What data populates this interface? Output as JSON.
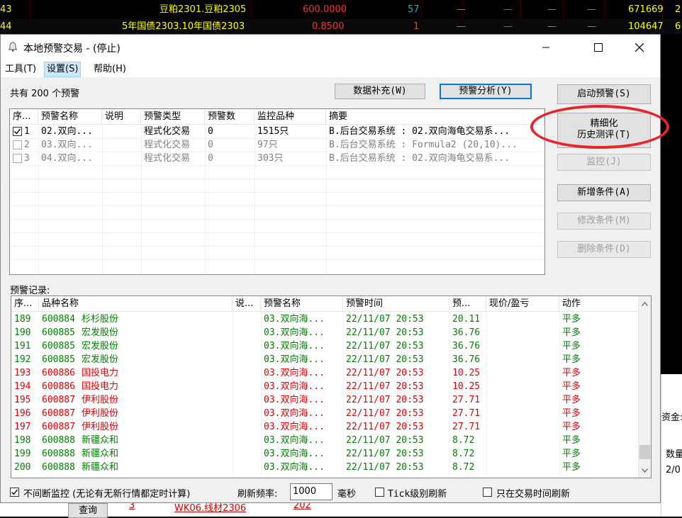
{
  "background": {
    "row1": {
      "idx": "43",
      "name": "豆粕2301.豆粕2305",
      "price": "600.0000",
      "vol": "57",
      "d1": "—",
      "d2": "—",
      "d3": "—",
      "d4": "—",
      "amount": "671669",
      "tail": "2"
    },
    "row2": {
      "idx": "44",
      "name": "5年国债2303.10年国债2303",
      "price": "0.8500",
      "vol": "1",
      "d1": "—",
      "d2": "—",
      "d3": "—",
      "d4": "—",
      "amount": "104647",
      "tail": "6"
    },
    "right_label_1": "资金:",
    "right_label_2": "数量",
    "right_label_3": "2/0",
    "query_button": "查询",
    "bottom_row": {
      "idx": "3",
      "name": "WK06.线材2306",
      "value": "202"
    }
  },
  "window": {
    "title": "本地预警交易  - (停止)",
    "controls": {
      "minimize": "—",
      "maximize": "☐",
      "close": "✕"
    }
  },
  "menu": [
    {
      "label": "工具(T)"
    },
    {
      "label": "设置(S)"
    },
    {
      "label": "帮助(H)"
    }
  ],
  "summary": "共有  200  个预警",
  "buttons": {
    "data_fill": "数据补充(W)",
    "alert_analysis": "预警分析(Y)",
    "start_alert": "启动预警(S)",
    "fine_backtest_line1": "精细化",
    "fine_backtest_line2": "历史测评(T)",
    "monitor": "监控(J)",
    "add_condition": "新增条件(A)",
    "modify_condition": "修改条件(M)",
    "delete_condition": "删除条件(D)"
  },
  "alerts_table": {
    "headers": [
      "序...",
      "预警名称",
      "说明",
      "预警类型",
      "预警数",
      "监控品种",
      "摘要"
    ],
    "rows": [
      {
        "checked": true,
        "enabled": true,
        "idx": "1",
        "name": "02.双向...",
        "desc": "",
        "type": "程式化交易",
        "count": "0",
        "symbols": "1515只",
        "summary": "B.后台交易系统 : 02.双向海龟交易系..."
      },
      {
        "checked": false,
        "enabled": false,
        "idx": "2",
        "name": "03.双向...",
        "desc": "",
        "type": "程式化交易",
        "count": "0",
        "symbols": "97只",
        "summary": "B.后台交易系统 : Formula2 (20,10)..."
      },
      {
        "checked": false,
        "enabled": false,
        "idx": "3",
        "name": "04.双向...",
        "desc": "",
        "type": "程式化交易",
        "count": "0",
        "symbols": "303只",
        "summary": "B.后台交易系统 : 02.双向海龟交易系..."
      }
    ]
  },
  "records_label": "预警记录:",
  "records_table": {
    "headers": [
      "序...",
      "品种名称",
      "说...",
      "预警名称",
      "预警时间",
      "预...",
      "现价/盈亏",
      "动作"
    ],
    "rows": [
      {
        "idx": "189",
        "code": "600884",
        "name": "杉杉股份",
        "alert": "03.双向海...",
        "time": "22/11/07 20:53",
        "price": "20.11",
        "action": "平多",
        "color": "#008000"
      },
      {
        "idx": "190",
        "code": "600885",
        "name": "宏发股份",
        "alert": "03.双向海...",
        "time": "22/11/07 20:53",
        "price": "36.76",
        "action": "平多",
        "color": "#008000"
      },
      {
        "idx": "191",
        "code": "600885",
        "name": "宏发股份",
        "alert": "03.双向海...",
        "time": "22/11/07 20:53",
        "price": "36.76",
        "action": "平多",
        "color": "#008000"
      },
      {
        "idx": "192",
        "code": "600885",
        "name": "宏发股份",
        "alert": "03.双向海...",
        "time": "22/11/07 20:53",
        "price": "36.76",
        "action": "平多",
        "color": "#008000"
      },
      {
        "idx": "193",
        "code": "600886",
        "name": "国投电力",
        "alert": "03.双向海...",
        "time": "22/11/07 20:53",
        "price": "10.25",
        "action": "平多",
        "color": "#e00000"
      },
      {
        "idx": "194",
        "code": "600886",
        "name": "国投电力",
        "alert": "03.双向海...",
        "time": "22/11/07 20:53",
        "price": "10.25",
        "action": "平多",
        "color": "#e00000"
      },
      {
        "idx": "195",
        "code": "600887",
        "name": "伊利股份",
        "alert": "03.双向海...",
        "time": "22/11/07 20:53",
        "price": "27.71",
        "action": "平多",
        "color": "#e00000"
      },
      {
        "idx": "196",
        "code": "600887",
        "name": "伊利股份",
        "alert": "03.双向海...",
        "time": "22/11/07 20:53",
        "price": "27.71",
        "action": "平多",
        "color": "#e00000"
      },
      {
        "idx": "197",
        "code": "600887",
        "name": "伊利股份",
        "alert": "03.双向海...",
        "time": "22/11/07 20:53",
        "price": "27.71",
        "action": "平多",
        "color": "#e00000"
      },
      {
        "idx": "198",
        "code": "600888",
        "name": "新疆众和",
        "alert": "03.双向海...",
        "time": "22/11/07 20:53",
        "price": "8.72",
        "action": "平多",
        "color": "#008000"
      },
      {
        "idx": "199",
        "code": "600888",
        "name": "新疆众和",
        "alert": "03.双向海...",
        "time": "22/11/07 20:53",
        "price": "8.72",
        "action": "平多",
        "color": "#008000"
      },
      {
        "idx": "200",
        "code": "600888",
        "name": "新疆众和",
        "alert": "03.双向海...",
        "time": "22/11/07 20:53",
        "price": "8.72",
        "action": "平多",
        "color": "#008000"
      }
    ]
  },
  "bottom": {
    "continuous_monitor_checked": true,
    "continuous_monitor_label": "不间断监控 (无论有无新行情都定时计算)",
    "refresh_label": "刷新频率:",
    "refresh_value": "1000",
    "refresh_unit": "毫秒",
    "tick_refresh_checked": false,
    "tick_refresh_label": "Tick级别刷新",
    "trading_hours_checked": false,
    "trading_hours_label": "只在交易时间刷新"
  },
  "colors": {
    "highlight_ring": "#e8242a",
    "green_text": "#008000",
    "red_text": "#e00000",
    "bg_yellow": "#ffff00",
    "bg_red": "#ff3030",
    "bg_cyan": "#00c0c0"
  }
}
